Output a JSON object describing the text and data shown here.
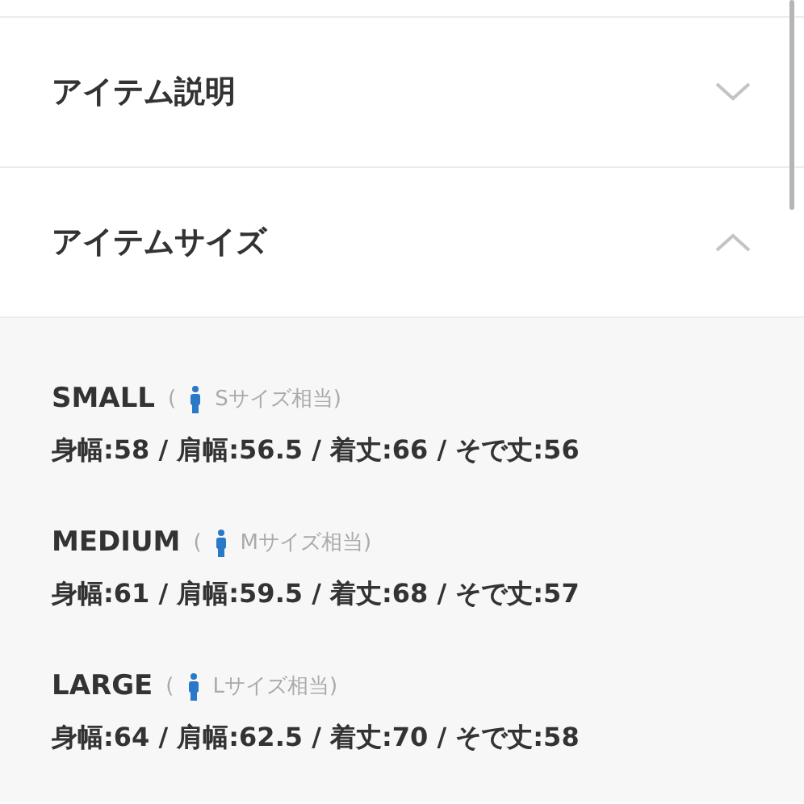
{
  "sections": [
    {
      "title": "アイテム説明",
      "expanded": false
    },
    {
      "title": "アイテムサイズ",
      "expanded": true
    }
  ],
  "sizes": [
    {
      "name": "SMALL",
      "paren": "(",
      "note": "Sサイズ相当)",
      "specs": "身幅:58 / 肩幅:56.5 / 着丈:66 / そで丈:56"
    },
    {
      "name": "MEDIUM",
      "paren": "(",
      "note": "Mサイズ相当)",
      "specs": "身幅:61 / 肩幅:59.5 / 着丈:68 / そで丈:57"
    },
    {
      "name": "LARGE",
      "paren": "(",
      "note": "Lサイズ相当)",
      "specs": "身幅:64 / 肩幅:62.5 / 着丈:70 / そで丈:58"
    }
  ]
}
